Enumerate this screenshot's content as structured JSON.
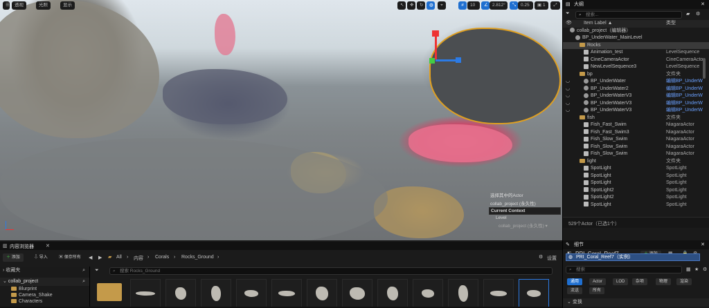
{
  "viewport": {
    "top_left_buttons": [
      "透视",
      "光照",
      "显示"
    ],
    "top_right": {
      "grid_value": "10",
      "angle_value": "2.812°",
      "scale_value": "0.25",
      "camera_speed": "1"
    },
    "context": {
      "line1": "选择其中的Actor",
      "line2": "collab_project (永久性)",
      "title": "Current Context",
      "level_label": "Level",
      "level_value": "collab_project (永久性)"
    }
  },
  "outliner": {
    "tab_title": "大纲",
    "search_placeholder": "搜索...",
    "col_label": "Item Label ▲",
    "col_type": "类型",
    "rows": [
      {
        "label": "collab_project（编辑器）",
        "type": ""
      },
      {
        "label": "BP_UnderWater_MainLevel",
        "type": ""
      },
      {
        "label": "Rocks",
        "type": ""
      },
      {
        "label": "Animation_test",
        "type": "LevelSequence"
      },
      {
        "label": "CineCameraActor",
        "type": "CineCameraActor"
      },
      {
        "label": "NewLevelSequence3",
        "type": "LevelSequence"
      },
      {
        "label": "bp",
        "type": "文件夹"
      },
      {
        "label": "BP_UnderWater",
        "type": "编辑BP_UnderW"
      },
      {
        "label": "BP_UnderWater2",
        "type": "编辑BP_UnderW"
      },
      {
        "label": "BP_UnderWaterV3",
        "type": "编辑BP_UnderW"
      },
      {
        "label": "BP_UnderWaterV3",
        "type": "编辑BP_UnderW"
      },
      {
        "label": "BP_UnderWaterV3",
        "type": "编辑BP_UnderW"
      },
      {
        "label": "fish",
        "type": "文件夹"
      },
      {
        "label": "Fish_Fast_Swim",
        "type": "NiagaraActor"
      },
      {
        "label": "Fish_Fast_Swim3",
        "type": "NiagaraActor"
      },
      {
        "label": "Fish_Slow_Swim",
        "type": "NiagaraActor"
      },
      {
        "label": "Fish_Slow_Swim",
        "type": "NiagaraActor"
      },
      {
        "label": "Fish_Slow_Swim",
        "type": "NiagaraActor"
      },
      {
        "label": "light",
        "type": "文件夹"
      },
      {
        "label": "SpotLight",
        "type": "SpotLight"
      },
      {
        "label": "SpotLight",
        "type": "SpotLight"
      },
      {
        "label": "SpotLight",
        "type": "SpotLight"
      },
      {
        "label": "SpotLight2",
        "type": "SpotLight"
      },
      {
        "label": "SpotLight2",
        "type": "SpotLight"
      },
      {
        "label": "SpotLight",
        "type": "SpotLight"
      }
    ],
    "footer": "529个Actor（已选1个）"
  },
  "content_browser": {
    "tab_title": "内容浏览器",
    "add": "添加",
    "import": "导入",
    "save_all": "保存所有",
    "breadcrumb": [
      "All",
      "内容",
      "Corals",
      "Rocks_Ground"
    ],
    "settings": "设置",
    "favorites": "收藏夹",
    "project": "collab_project",
    "folders": [
      "Blurprint",
      "Camera_Shake",
      "Characters"
    ],
    "search_placeholder": "搜索 Rocks_Ground"
  },
  "details": {
    "tab_title": "细节",
    "actor_name": "PRI_Coral_Reef7",
    "add": "添加",
    "instance": "PRI_Coral_Reef7（实例）",
    "search_placeholder": "搜索",
    "filters_row1": [
      "通用",
      "Actor",
      "LOD",
      "杂项",
      "物理",
      "渲染"
    ],
    "filters_row2": [
      "流送",
      "所有"
    ],
    "section": "变换"
  }
}
